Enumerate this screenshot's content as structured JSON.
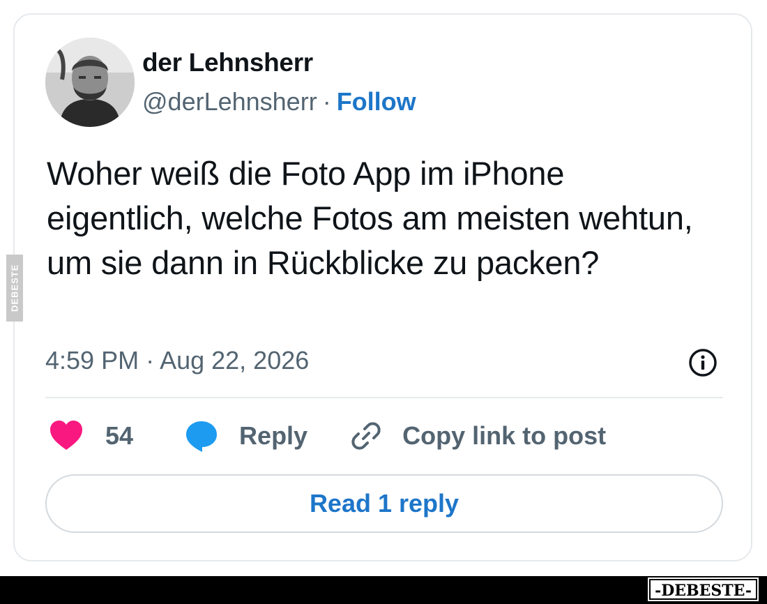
{
  "post": {
    "author": {
      "name": "der Lehnsherr",
      "handle": "@derLehnsherr",
      "separator": "·",
      "follow_label": "Follow"
    },
    "text": "Woher weiß die Foto App im iPhone eigentlich, welche Fotos am meisten wehtun, um sie dann in Rückblicke zu packen?",
    "timestamp": "4:59 PM · Aug 22, 2026",
    "actions": {
      "like_count": "54",
      "reply_label": "Reply",
      "copy_link_label": "Copy link to post"
    },
    "read_replies_label": "Read 1 reply"
  },
  "icons": {
    "like": "heart-icon",
    "reply": "speech-bubble-icon",
    "copy_link": "link-icon",
    "info": "info-icon"
  },
  "colors": {
    "like": "#f91880",
    "reply": "#1d9bf0",
    "link_accent": "#1d76c9",
    "text": "#0f1419",
    "secondary": "#536471"
  },
  "watermark": {
    "side": "DEBESTE",
    "logo": "-DEBESTE-"
  }
}
